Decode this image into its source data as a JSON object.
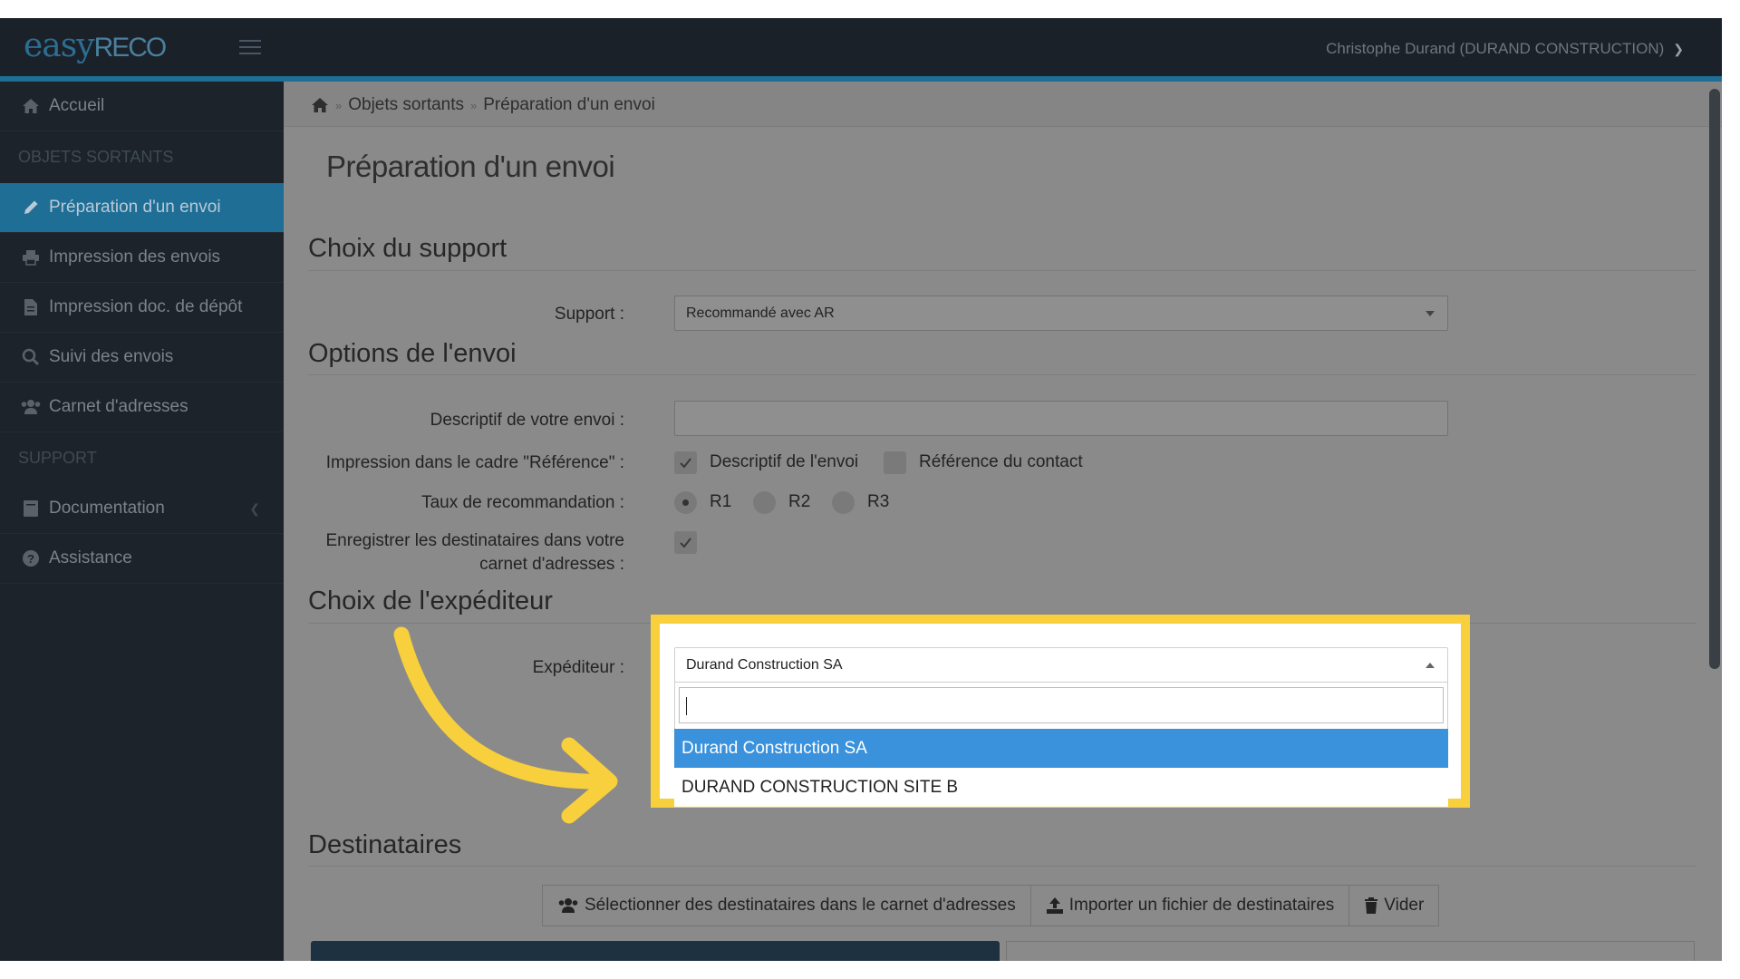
{
  "app": {
    "logo_easy": "easy",
    "logo_reco": "RECO",
    "user": "Christophe Durand (DURAND CONSTRUCTION)"
  },
  "sidebar": {
    "items": [
      {
        "label": "Accueil",
        "icon": "home-icon"
      },
      {
        "label": "Préparation d'un envoi",
        "icon": "pencil-icon",
        "active": true
      },
      {
        "label": "Impression des envois",
        "icon": "printer-icon"
      },
      {
        "label": "Impression doc. de dépôt",
        "icon": "document-icon"
      },
      {
        "label": "Suivi des envois",
        "icon": "search-icon"
      },
      {
        "label": "Carnet d'adresses",
        "icon": "users-icon"
      },
      {
        "label": "Documentation",
        "icon": "book-icon"
      },
      {
        "label": "Assistance",
        "icon": "help-icon"
      }
    ],
    "headers": {
      "outgoing": "OBJETS SORTANTS",
      "support": "SUPPORT"
    }
  },
  "breadcrumb": {
    "level1": "Objets sortants",
    "level2": "Préparation d'un envoi"
  },
  "page": {
    "title": "Préparation d'un envoi"
  },
  "sections": {
    "support": "Choix du support",
    "options": "Options de l'envoi",
    "sender": "Choix de l'expéditeur",
    "recipients": "Destinataires"
  },
  "form": {
    "support_label": "Support :",
    "support_value": "Recommandé avec AR",
    "description_label": "Descriptif de votre envoi :",
    "description_value": "",
    "reference_label": "Impression dans le cadre \"Référence\" :",
    "ref_opt1": "Descriptif de l'envoi",
    "ref_opt1_checked": true,
    "ref_opt2": "Référence du contact",
    "ref_opt2_checked": false,
    "rate_label": "Taux de recommandation :",
    "rate_options": [
      "R1",
      "R2",
      "R3"
    ],
    "rate_selected": "R1",
    "save_label_line1": "Enregistrer les destinataires dans votre",
    "save_label_line2": "carnet d'adresses :",
    "save_checked": true,
    "sender_label": "Expéditeur :",
    "sender_value": "Durand Construction SA",
    "sender_search": "",
    "sender_options": [
      "Durand Construction SA",
      "DURAND CONSTRUCTION SITE B"
    ]
  },
  "buttons": {
    "select_recipients": "Sélectionner des destinataires dans le carnet d'adresses",
    "import_file": "Importer un fichier de destinataires",
    "clear": "Vider"
  },
  "colors": {
    "accent": "#1f6e96",
    "highlight": "#f8cf3c",
    "selected_option": "#3a91dc",
    "sidebar_bg": "#1c232b"
  }
}
